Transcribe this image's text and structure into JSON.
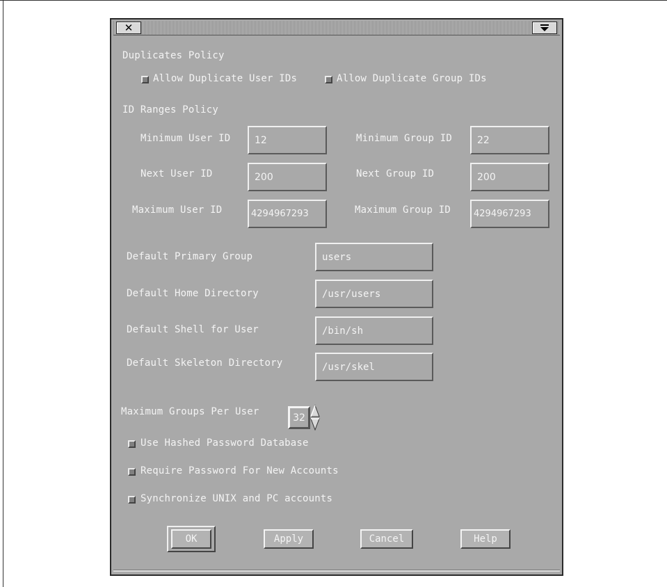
{
  "titlebar": {
    "close_icon": "close-icon",
    "menu_icon": "window-menu-icon"
  },
  "duplicates": {
    "heading": "Duplicates Policy",
    "allow_user_ids": "Allow Duplicate User IDs",
    "allow_group_ids": "Allow Duplicate Group IDs"
  },
  "id_ranges": {
    "heading": "ID Ranges Policy",
    "min_user_label": "Minimum User ID",
    "min_user_value": "12",
    "next_user_label": "Next User ID",
    "next_user_value": "200",
    "max_user_label": "Maximum User ID",
    "max_user_value": "4294967293",
    "min_group_label": "Minimum Group ID",
    "min_group_value": "22",
    "next_group_label": "Next Group ID",
    "next_group_value": "200",
    "max_group_label": "Maximum Group ID",
    "max_group_value": "4294967293"
  },
  "defaults": {
    "primary_group_label": "Default Primary Group",
    "primary_group_value": "users",
    "home_dir_label": "Default Home Directory",
    "home_dir_value": "/usr/users",
    "shell_label": "Default Shell for User",
    "shell_value": "/bin/sh",
    "skeleton_label": "Default Skeleton Directory",
    "skeleton_value": "/usr/skel"
  },
  "max_groups": {
    "label": "Maximum Groups Per User",
    "value": "32"
  },
  "options": {
    "hashed_password": "Use Hashed Password Database",
    "require_password": "Require Password For New Accounts",
    "synchronize": "Synchronize UNIX and PC accounts"
  },
  "buttons": {
    "ok": "OK",
    "apply": "Apply",
    "cancel": "Cancel",
    "help": "Help"
  }
}
